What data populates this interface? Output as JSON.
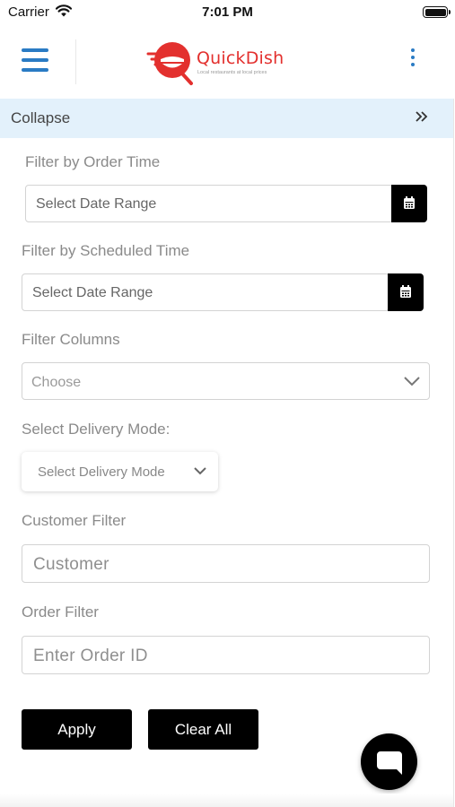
{
  "status_bar": {
    "carrier": "Carrier",
    "time": "7:01 PM"
  },
  "header": {
    "logo": {
      "name": "QuickDish",
      "tagline": "Local restaurants at local prices",
      "brand_color": "#e3302e"
    },
    "menu_icon": "hamburger-icon",
    "more_icon": "kebab-icon",
    "accent_color": "#2a7bc4"
  },
  "filter_panel": {
    "collapse_label": "Collapse",
    "order_time": {
      "label": "Filter by Order Time",
      "placeholder": "Select Date Range"
    },
    "scheduled_time": {
      "label": "Filter by Scheduled Time",
      "placeholder": "Select Date Range"
    },
    "columns": {
      "label": "Filter Columns",
      "placeholder": "Choose"
    },
    "delivery_mode": {
      "label": "Select Delivery Mode:",
      "placeholder": "Select Delivery Mode"
    },
    "customer": {
      "label": "Customer Filter",
      "placeholder": "Customer"
    },
    "order": {
      "label": "Order Filter",
      "placeholder": "Enter Order ID"
    },
    "apply_label": "Apply",
    "clear_label": "Clear All"
  },
  "chat": {
    "icon": "chat-bubble-icon"
  }
}
